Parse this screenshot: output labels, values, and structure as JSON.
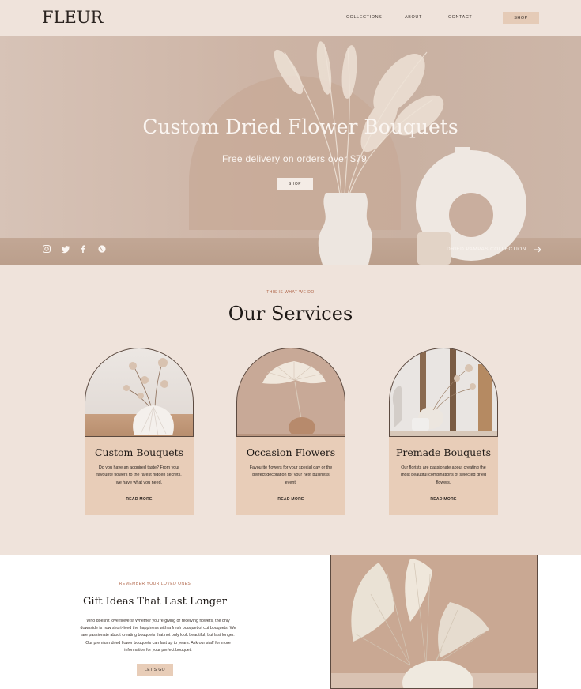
{
  "header": {
    "logo": "FLEUR",
    "nav": [
      "COLLECTIONS",
      "ABOUT",
      "CONTACT"
    ],
    "shop_label": "SHOP"
  },
  "hero": {
    "title": "Custom Dried Flower Bouquets",
    "subtitle": "Free delivery on orders over $79",
    "button_label": "SHOP",
    "social_icons": [
      "instagram-icon",
      "twitter-icon",
      "facebook-icon",
      "globe-icon"
    ],
    "collection_link": "DRIED PAMPAS COLLECTION"
  },
  "services": {
    "eyebrow": "THIS IS WHAT WE DO",
    "title": "Our Services",
    "cards": [
      {
        "title": "Custom Bouquets",
        "description": "Do you have an acquired taste? From your favourite flowers to the rarest hidden secrets, we have what you need.",
        "link": "READ MORE"
      },
      {
        "title": "Occasion Flowers",
        "description": "Favourite flowers for your special day or the perfect decoration for your next business event.",
        "link": "READ MORE"
      },
      {
        "title": "Premade Bouquets",
        "description": "Our florists are passionate about creating the most beautiful combinations of selected dried flowers.",
        "link": "READ MORE"
      }
    ]
  },
  "gift": {
    "eyebrow": "REMEMBER YOUR LOVED ONES",
    "title": "Gift Ideas That Last Longer",
    "text": "Who doesn't love flowers! Whether you're giving or receiving flowers, the only downside is how short-lived the happiness with a fresh bouquet of cut bouquets. We are passionate about creating bouquets that not only look beautiful, but last longer. Our premium dried flower bouquets can last up to years. Ask our staff for more information for your perfect bouquet.",
    "button_label": "LET'S GO"
  },
  "colors": {
    "background": "#efe3db",
    "card": "#e8cdb8",
    "accent": "#b0664a",
    "text": "#1e1916"
  }
}
